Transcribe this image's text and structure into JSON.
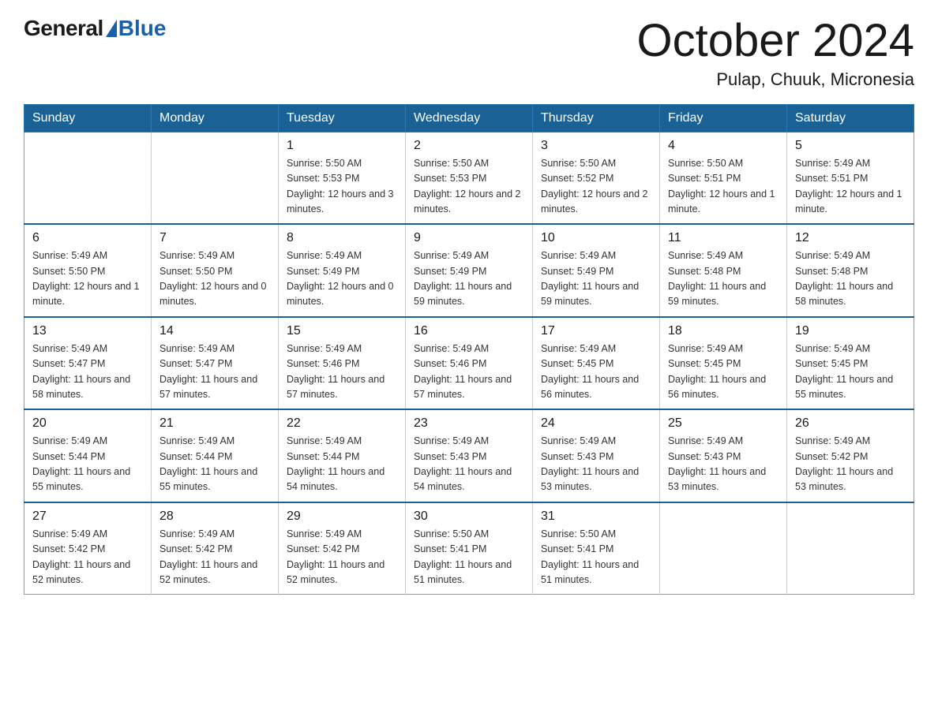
{
  "logo": {
    "general": "General",
    "blue": "Blue"
  },
  "title": {
    "month_year": "October 2024",
    "location": "Pulap, Chuuk, Micronesia"
  },
  "days_of_week": [
    "Sunday",
    "Monday",
    "Tuesday",
    "Wednesday",
    "Thursday",
    "Friday",
    "Saturday"
  ],
  "weeks": [
    [
      {
        "day": "",
        "info": ""
      },
      {
        "day": "",
        "info": ""
      },
      {
        "day": "1",
        "info": "Sunrise: 5:50 AM\nSunset: 5:53 PM\nDaylight: 12 hours\nand 3 minutes."
      },
      {
        "day": "2",
        "info": "Sunrise: 5:50 AM\nSunset: 5:53 PM\nDaylight: 12 hours\nand 2 minutes."
      },
      {
        "day": "3",
        "info": "Sunrise: 5:50 AM\nSunset: 5:52 PM\nDaylight: 12 hours\nand 2 minutes."
      },
      {
        "day": "4",
        "info": "Sunrise: 5:50 AM\nSunset: 5:51 PM\nDaylight: 12 hours\nand 1 minute."
      },
      {
        "day": "5",
        "info": "Sunrise: 5:49 AM\nSunset: 5:51 PM\nDaylight: 12 hours\nand 1 minute."
      }
    ],
    [
      {
        "day": "6",
        "info": "Sunrise: 5:49 AM\nSunset: 5:50 PM\nDaylight: 12 hours\nand 1 minute."
      },
      {
        "day": "7",
        "info": "Sunrise: 5:49 AM\nSunset: 5:50 PM\nDaylight: 12 hours\nand 0 minutes."
      },
      {
        "day": "8",
        "info": "Sunrise: 5:49 AM\nSunset: 5:49 PM\nDaylight: 12 hours\nand 0 minutes."
      },
      {
        "day": "9",
        "info": "Sunrise: 5:49 AM\nSunset: 5:49 PM\nDaylight: 11 hours\nand 59 minutes."
      },
      {
        "day": "10",
        "info": "Sunrise: 5:49 AM\nSunset: 5:49 PM\nDaylight: 11 hours\nand 59 minutes."
      },
      {
        "day": "11",
        "info": "Sunrise: 5:49 AM\nSunset: 5:48 PM\nDaylight: 11 hours\nand 59 minutes."
      },
      {
        "day": "12",
        "info": "Sunrise: 5:49 AM\nSunset: 5:48 PM\nDaylight: 11 hours\nand 58 minutes."
      }
    ],
    [
      {
        "day": "13",
        "info": "Sunrise: 5:49 AM\nSunset: 5:47 PM\nDaylight: 11 hours\nand 58 minutes."
      },
      {
        "day": "14",
        "info": "Sunrise: 5:49 AM\nSunset: 5:47 PM\nDaylight: 11 hours\nand 57 minutes."
      },
      {
        "day": "15",
        "info": "Sunrise: 5:49 AM\nSunset: 5:46 PM\nDaylight: 11 hours\nand 57 minutes."
      },
      {
        "day": "16",
        "info": "Sunrise: 5:49 AM\nSunset: 5:46 PM\nDaylight: 11 hours\nand 57 minutes."
      },
      {
        "day": "17",
        "info": "Sunrise: 5:49 AM\nSunset: 5:45 PM\nDaylight: 11 hours\nand 56 minutes."
      },
      {
        "day": "18",
        "info": "Sunrise: 5:49 AM\nSunset: 5:45 PM\nDaylight: 11 hours\nand 56 minutes."
      },
      {
        "day": "19",
        "info": "Sunrise: 5:49 AM\nSunset: 5:45 PM\nDaylight: 11 hours\nand 55 minutes."
      }
    ],
    [
      {
        "day": "20",
        "info": "Sunrise: 5:49 AM\nSunset: 5:44 PM\nDaylight: 11 hours\nand 55 minutes."
      },
      {
        "day": "21",
        "info": "Sunrise: 5:49 AM\nSunset: 5:44 PM\nDaylight: 11 hours\nand 55 minutes."
      },
      {
        "day": "22",
        "info": "Sunrise: 5:49 AM\nSunset: 5:44 PM\nDaylight: 11 hours\nand 54 minutes."
      },
      {
        "day": "23",
        "info": "Sunrise: 5:49 AM\nSunset: 5:43 PM\nDaylight: 11 hours\nand 54 minutes."
      },
      {
        "day": "24",
        "info": "Sunrise: 5:49 AM\nSunset: 5:43 PM\nDaylight: 11 hours\nand 53 minutes."
      },
      {
        "day": "25",
        "info": "Sunrise: 5:49 AM\nSunset: 5:43 PM\nDaylight: 11 hours\nand 53 minutes."
      },
      {
        "day": "26",
        "info": "Sunrise: 5:49 AM\nSunset: 5:42 PM\nDaylight: 11 hours\nand 53 minutes."
      }
    ],
    [
      {
        "day": "27",
        "info": "Sunrise: 5:49 AM\nSunset: 5:42 PM\nDaylight: 11 hours\nand 52 minutes."
      },
      {
        "day": "28",
        "info": "Sunrise: 5:49 AM\nSunset: 5:42 PM\nDaylight: 11 hours\nand 52 minutes."
      },
      {
        "day": "29",
        "info": "Sunrise: 5:49 AM\nSunset: 5:42 PM\nDaylight: 11 hours\nand 52 minutes."
      },
      {
        "day": "30",
        "info": "Sunrise: 5:50 AM\nSunset: 5:41 PM\nDaylight: 11 hours\nand 51 minutes."
      },
      {
        "day": "31",
        "info": "Sunrise: 5:50 AM\nSunset: 5:41 PM\nDaylight: 11 hours\nand 51 minutes."
      },
      {
        "day": "",
        "info": ""
      },
      {
        "day": "",
        "info": ""
      }
    ]
  ]
}
